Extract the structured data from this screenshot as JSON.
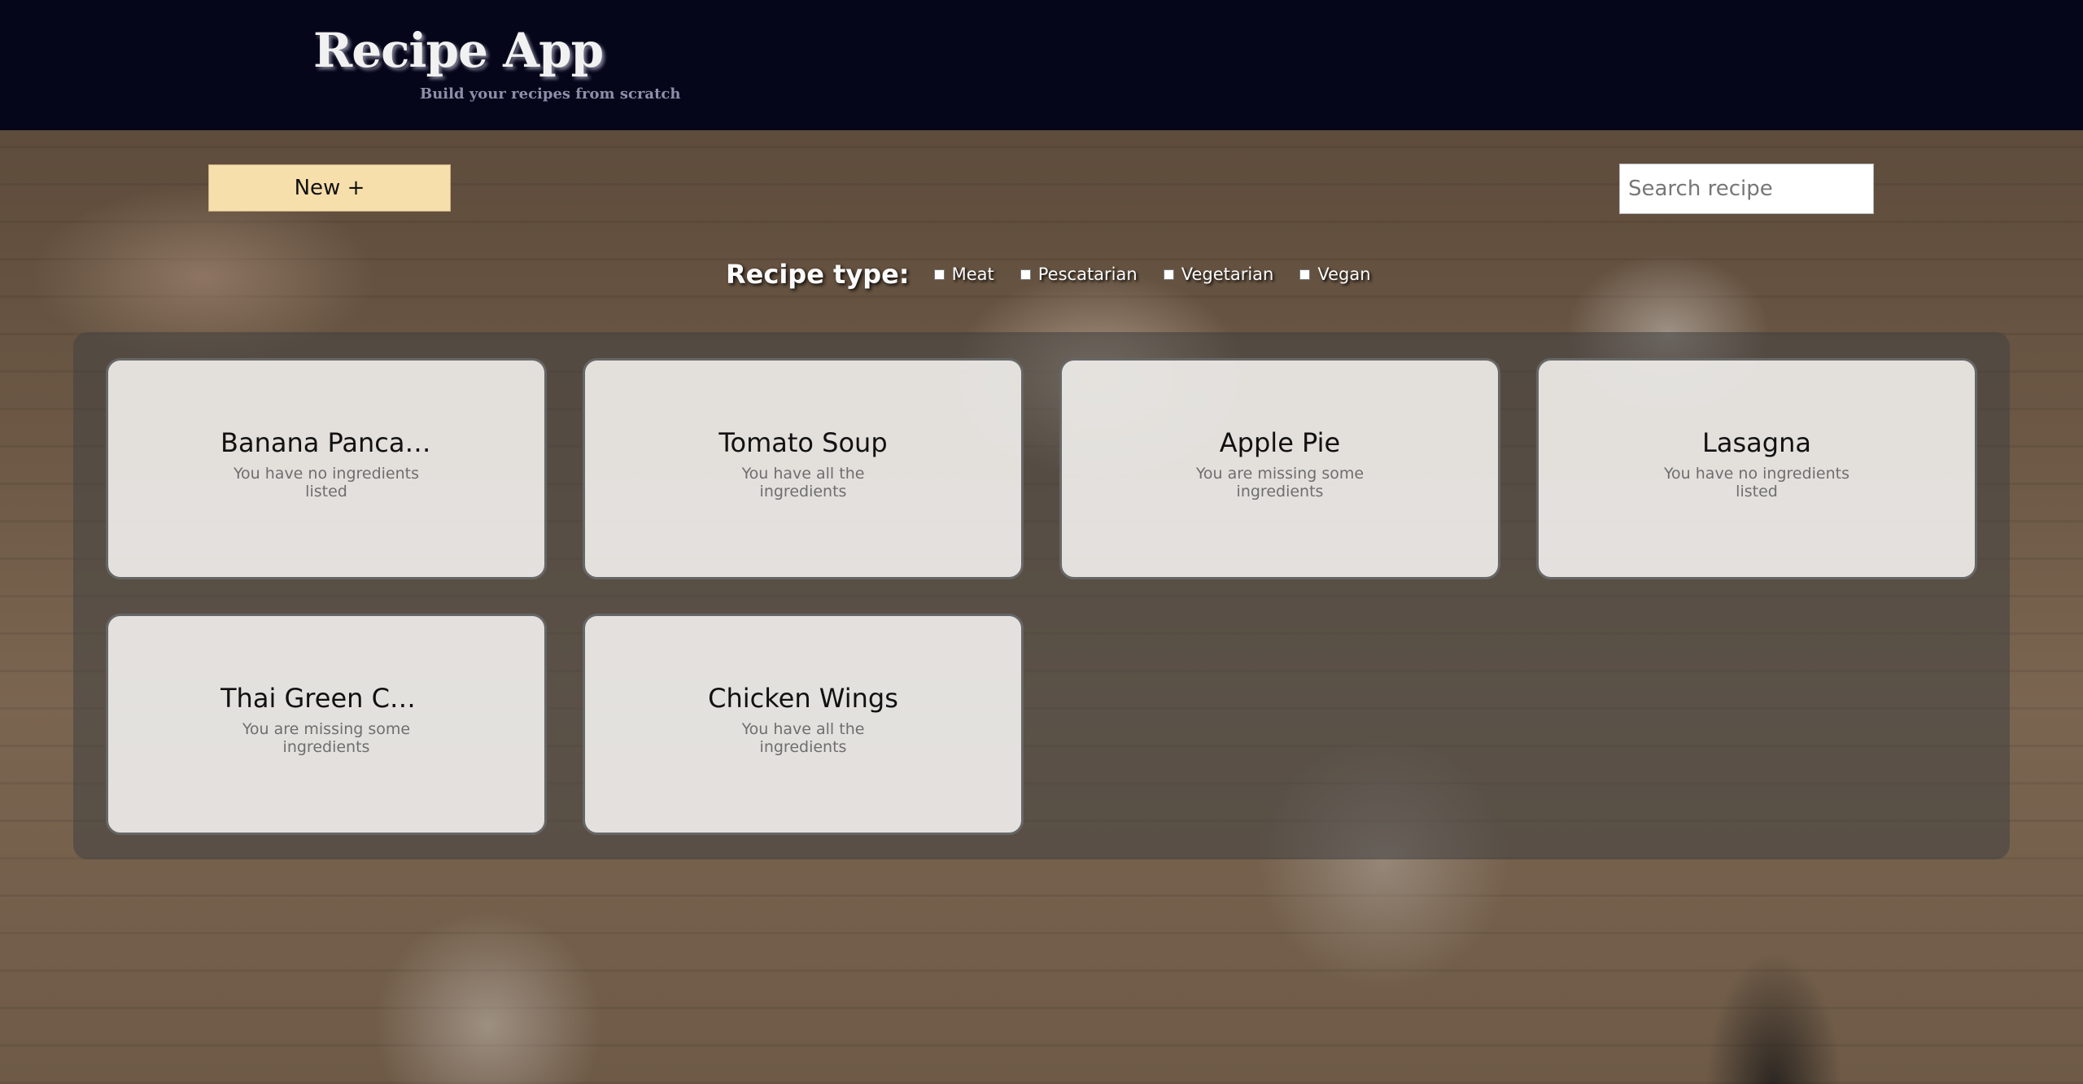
{
  "header": {
    "title": "Recipe App",
    "subtitle": "Build your recipes from scratch"
  },
  "toolbar": {
    "new_label": "New +",
    "search_placeholder": "Search recipe"
  },
  "filter": {
    "label": "Recipe type:",
    "options": [
      {
        "label": "Meat",
        "checked": false
      },
      {
        "label": "Pescatarian",
        "checked": false
      },
      {
        "label": "Vegetarian",
        "checked": false
      },
      {
        "label": "Vegan",
        "checked": false
      }
    ]
  },
  "recipes": [
    {
      "title": "Banana Pancakes",
      "status": "You have no ingredients listed"
    },
    {
      "title": "Tomato Soup",
      "status": "You have all the ingredients"
    },
    {
      "title": "Apple Pie",
      "status": "You are missing some ingredients"
    },
    {
      "title": "Lasagna",
      "status": "You have no ingredients listed"
    },
    {
      "title": "Thai Green Curry",
      "status": "You are missing some ingredients"
    },
    {
      "title": "Chicken Wings",
      "status": "You have all the ingredients"
    }
  ],
  "colors": {
    "header_bg": "#05061a",
    "new_button_bg": "#f7dfac",
    "card_bg": "#eeece8"
  }
}
